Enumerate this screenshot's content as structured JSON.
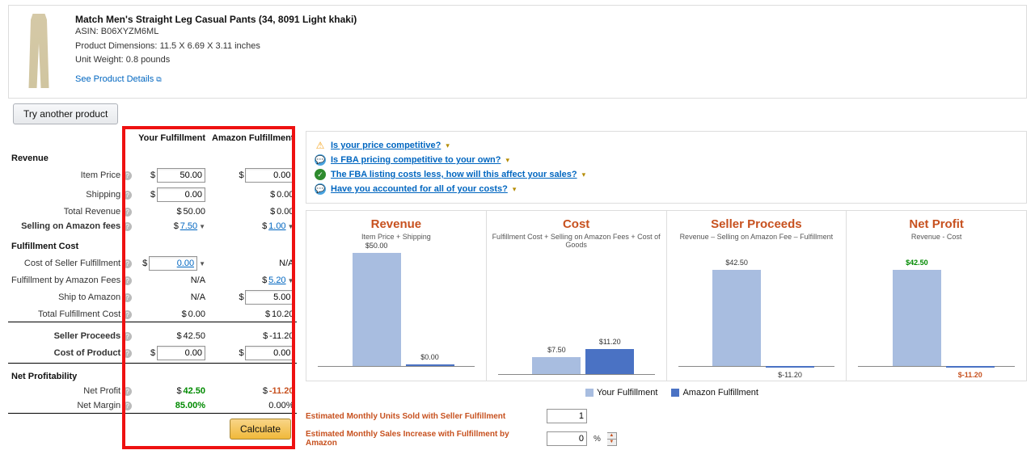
{
  "product": {
    "title": "Match Men's Straight Leg Casual Pants (34, 8091 Light khaki)",
    "asin_label": "ASIN:",
    "asin": "B06XYZM6ML",
    "dim_label": "Product Dimensions:",
    "dimensions": "11.5 X 6.69 X 3.11 inches",
    "weight_label": "Unit Weight:",
    "weight": "0.8 pounds",
    "see_details": "See Product Details"
  },
  "buttons": {
    "try_another": "Try another product",
    "calculate": "Calculate"
  },
  "cols": {
    "your": "Your Fulfillment",
    "amazon": "Amazon Fulfillment"
  },
  "sec": {
    "revenue": "Revenue",
    "fulfill": "Fulfillment Cost",
    "profit": "Net Profitability"
  },
  "rows": {
    "item_price": "Item Price",
    "shipping": "Shipping",
    "total_rev": "Total Revenue",
    "sell_fees": "Selling on Amazon fees",
    "seller_fulfill": "Cost of Seller Fulfillment",
    "fba_fees": "Fulfillment by Amazon Fees",
    "ship_to": "Ship to Amazon",
    "total_fulfill": "Total Fulfillment Cost",
    "proceeds": "Seller Proceeds",
    "cost_prod": "Cost of Product",
    "net_profit": "Net Profit",
    "net_margin": "Net Margin"
  },
  "vals": {
    "your": {
      "item_price": "50.00",
      "shipping": "0.00",
      "total_rev": "50.00",
      "sell_fees": "7.50",
      "seller_fulfill": "0.00",
      "fba_fees": "N/A",
      "ship_to": "N/A",
      "total_fulfill": "0.00",
      "proceeds": "42.50",
      "cost_prod": "0.00",
      "net_profit": "42.50",
      "net_margin": "85.00%"
    },
    "amz": {
      "item_price": "0.00",
      "shipping": "0.00",
      "total_rev": "0.00",
      "sell_fees": "1.00",
      "seller_fulfill": "N/A",
      "fba_fees": "5.20",
      "ship_to": "5.00",
      "total_fulfill": "10.20",
      "proceeds": "-11.20",
      "cost_prod": "0.00",
      "net_profit": "-11.20",
      "net_margin": "0.00%"
    }
  },
  "tips": [
    "Is your price competitive?",
    "Is FBA pricing competitive to your own?",
    "The FBA listing costs less, how will this affect your sales?",
    "Have you accounted for all of your costs?"
  ],
  "charts": {
    "titles": [
      "Revenue",
      "Cost",
      "Seller Proceeds",
      "Net Profit"
    ],
    "subs": [
      "Item Price + Shipping",
      "Fulfillment Cost + Selling on Amazon Fees + Cost of Goods",
      "Revenue – Selling on Amazon Fee – Fulfillment",
      "Revenue - Cost"
    ]
  },
  "chart_data": [
    {
      "type": "bar",
      "title": "Revenue",
      "categories": [
        "Your Fulfillment",
        "Amazon Fulfillment"
      ],
      "values": [
        50.0,
        0.0
      ],
      "labels": [
        "$50.00",
        "$0.00"
      ]
    },
    {
      "type": "bar",
      "title": "Cost",
      "categories": [
        "Your Fulfillment",
        "Amazon Fulfillment"
      ],
      "values": [
        7.5,
        11.2
      ],
      "labels": [
        "$7.50",
        "$11.20"
      ]
    },
    {
      "type": "bar",
      "title": "Seller Proceeds",
      "categories": [
        "Your Fulfillment",
        "Amazon Fulfillment"
      ],
      "values": [
        42.5,
        -11.2
      ],
      "labels": [
        "$42.50",
        "$-11.20"
      ]
    },
    {
      "type": "bar",
      "title": "Net Profit",
      "categories": [
        "Your Fulfillment",
        "Amazon Fulfillment"
      ],
      "values": [
        42.5,
        -11.2
      ],
      "labels": [
        "$42.50",
        "$-11.20"
      ]
    }
  ],
  "legend": {
    "your": "Your Fulfillment",
    "amazon": "Amazon Fulfillment"
  },
  "est": {
    "units_label": "Estimated Monthly Units Sold with Seller Fulfillment",
    "units_val": "1",
    "sales_label": "Estimated Monthly Sales Increase with Fulfillment by Amazon",
    "sales_val": "0",
    "pct": "%"
  }
}
